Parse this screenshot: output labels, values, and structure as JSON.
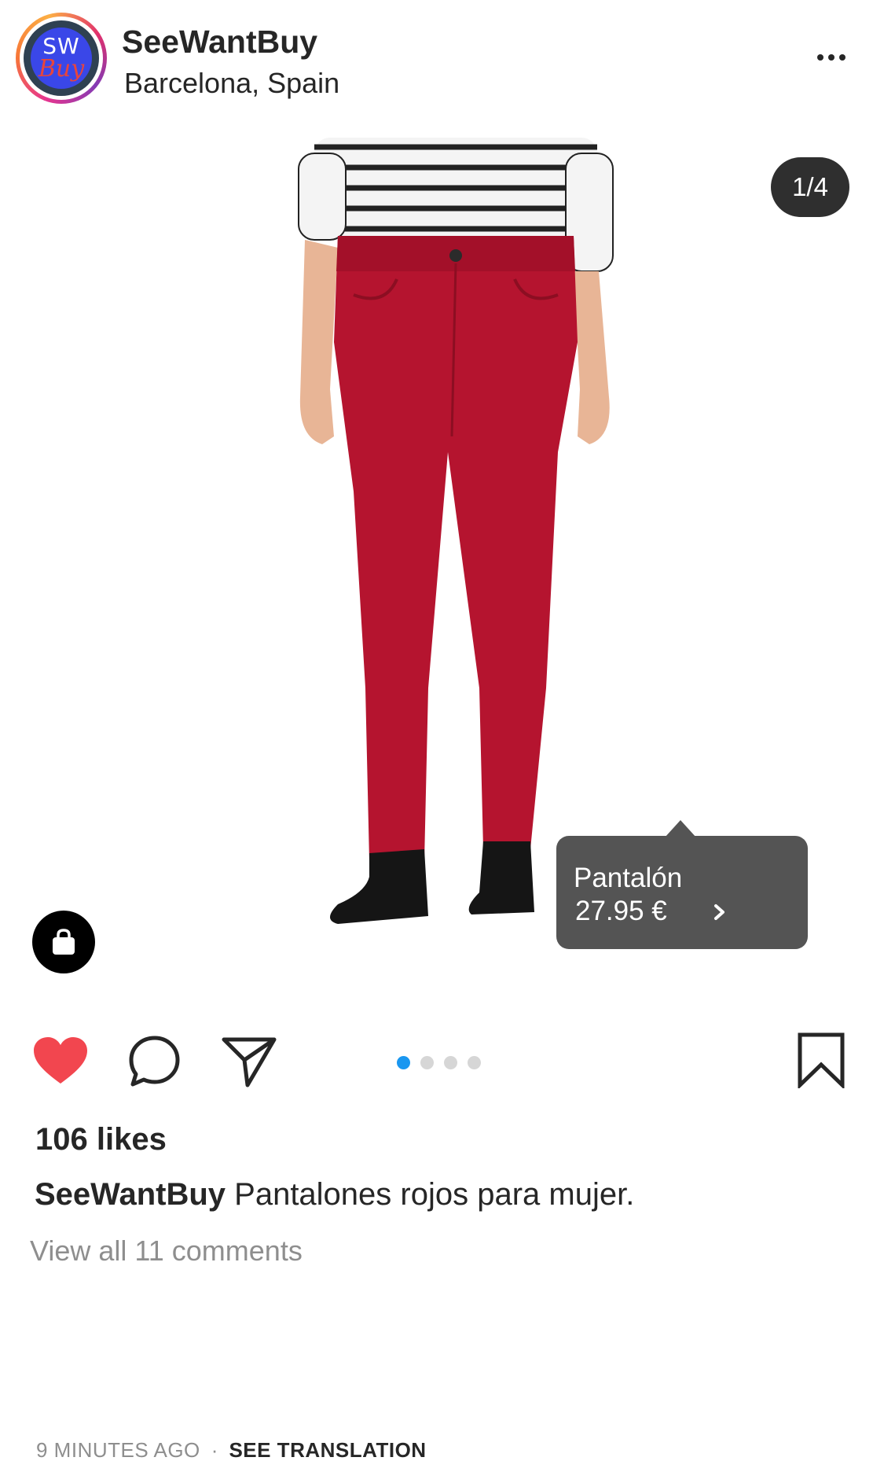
{
  "post": {
    "account": {
      "name": "SeeWantBuy",
      "location": "Barcelona, Spain",
      "avatar_text_top": "SW",
      "avatar_text_bottom": "Buy"
    },
    "media": {
      "counter": "1/4",
      "current_slide": 1,
      "total_slides": 4,
      "product_tag": {
        "name": "Pantalón",
        "price": "27.95 €"
      }
    },
    "actions": {
      "liked": true,
      "icons": [
        "heart-icon",
        "comment-icon",
        "share-icon",
        "bookmark-icon"
      ]
    },
    "likes": "106 likes",
    "caption": {
      "user": "SeeWantBuy",
      "text": "Pantalones rojos para mujer."
    },
    "comments_link": "View all 11 comments",
    "timestamp": "9 MINUTES AGO",
    "separator": "·",
    "translation_link": "SEE TRANSLATION"
  },
  "colors": {
    "like_red": "#f2464f",
    "active_dot": "#1a97f0",
    "pants_red": "#b5142f",
    "tag_bg": "#545454"
  }
}
